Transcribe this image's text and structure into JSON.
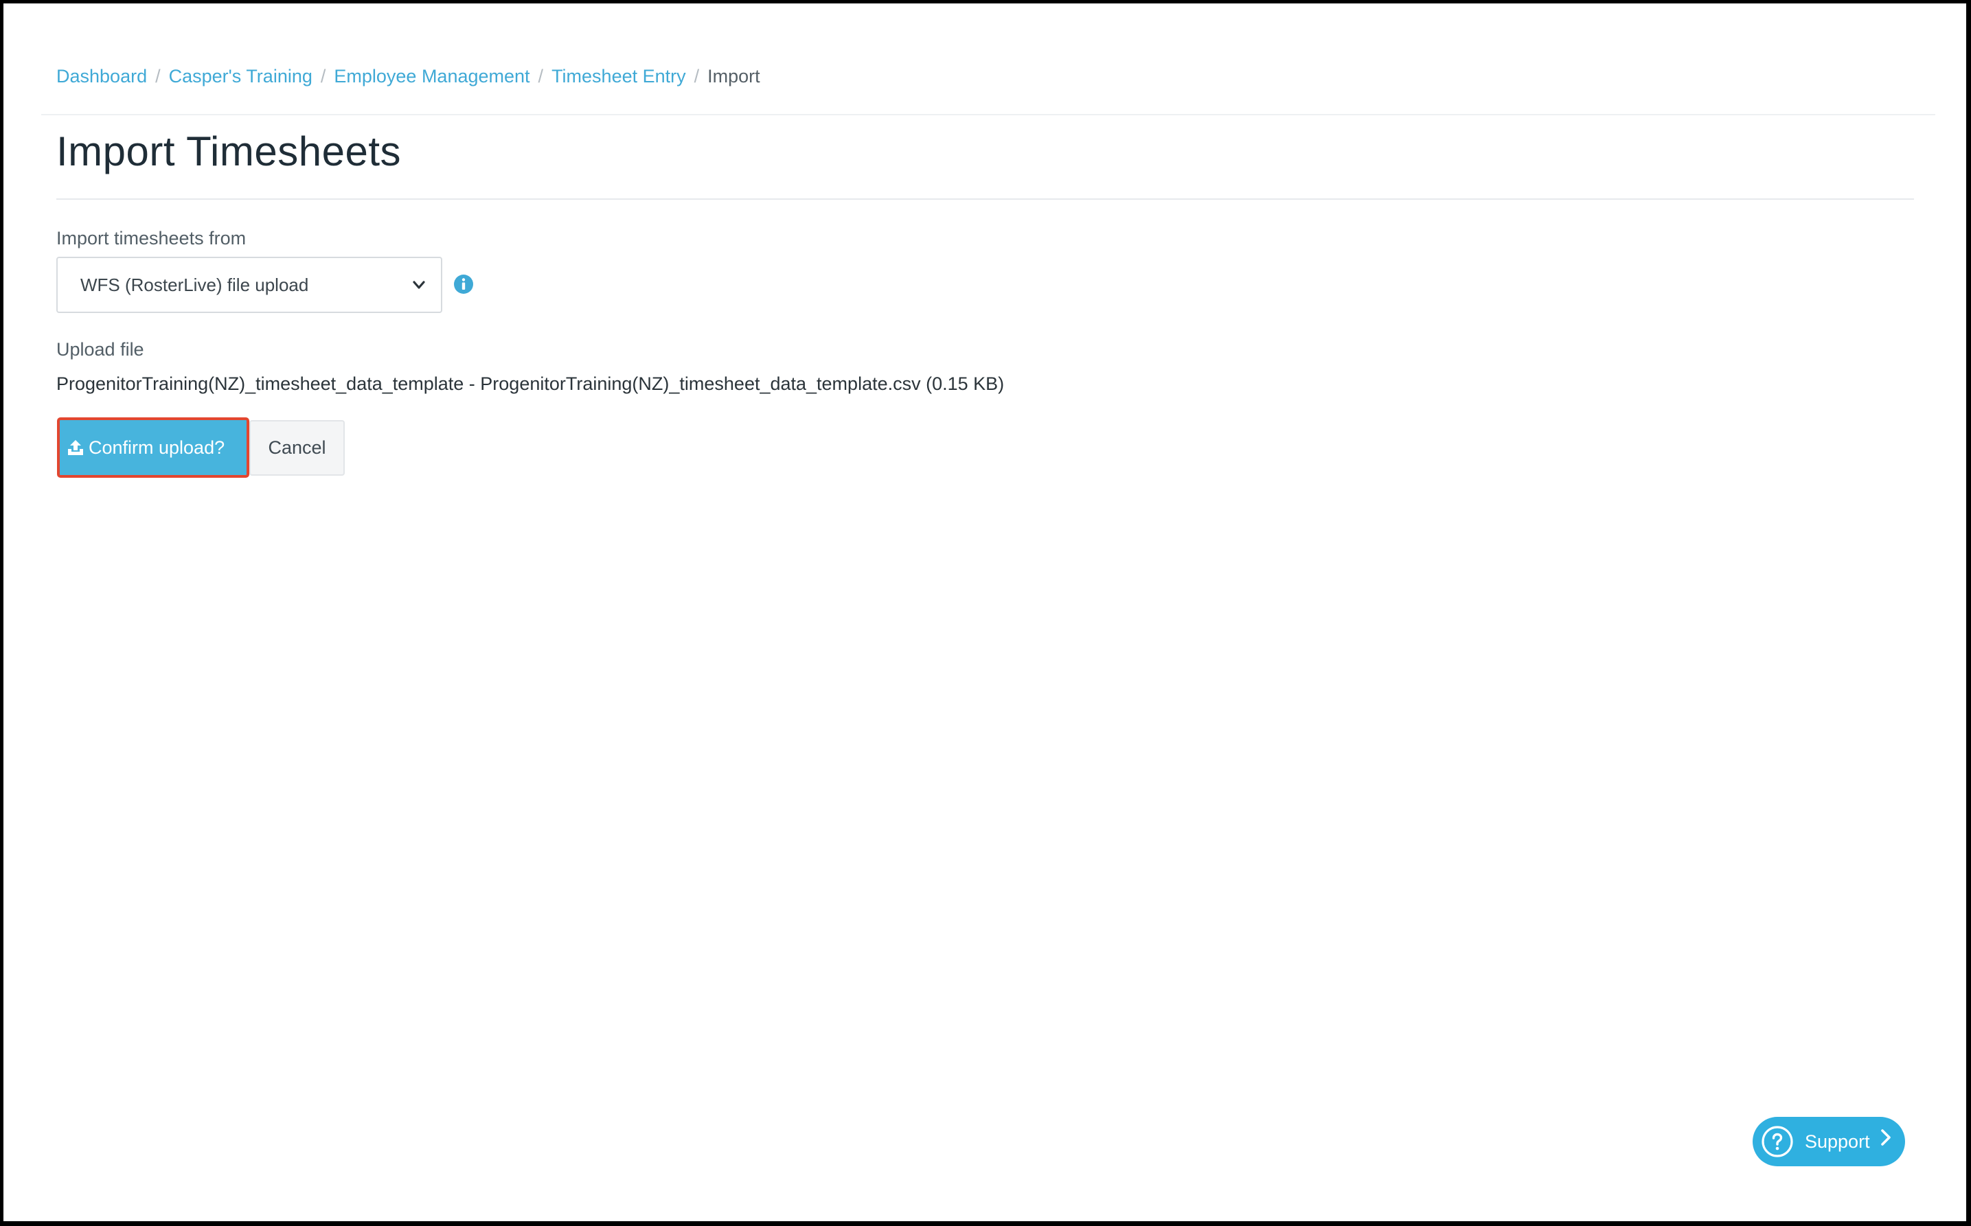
{
  "breadcrumb": {
    "items": [
      {
        "label": "Dashboard"
      },
      {
        "label": "Casper's Training"
      },
      {
        "label": "Employee Management"
      },
      {
        "label": "Timesheet Entry"
      }
    ],
    "current": "Import",
    "separator": "/"
  },
  "page": {
    "title": "Import Timesheets"
  },
  "import_from": {
    "label": "Import timesheets from",
    "selected": "WFS (RosterLive) file upload",
    "icon": "info-icon"
  },
  "upload": {
    "label": "Upload file",
    "file_text": "ProgenitorTraining(NZ)_timesheet_data_template - ProgenitorTraining(NZ)_timesheet_data_template.csv (0.15 KB)"
  },
  "actions": {
    "confirm_label": "Confirm upload?",
    "confirm_icon": "upload-icon",
    "cancel_label": "Cancel"
  },
  "support": {
    "label": "Support",
    "icon": "question-circle-icon"
  },
  "colors": {
    "accent": "#47b4dd",
    "link": "#3fa9d6",
    "highlight_border": "#e3462f",
    "support_bg": "#2fb0e0"
  }
}
